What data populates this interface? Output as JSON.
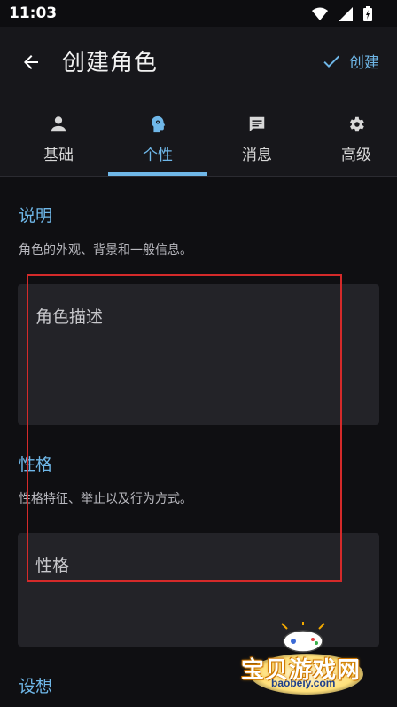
{
  "status_bar": {
    "time": "11:03"
  },
  "app_bar": {
    "title": "创建角色",
    "create_label": "创建"
  },
  "tabs": [
    {
      "label": "基础",
      "icon": "person-icon",
      "active": false
    },
    {
      "label": "个性",
      "icon": "head-gear-icon",
      "active": true
    },
    {
      "label": "消息",
      "icon": "chat-icon",
      "active": false
    },
    {
      "label": "高级",
      "icon": "gear-icon",
      "active": false
    }
  ],
  "sections": {
    "description": {
      "title": "说明",
      "desc": "角色的外观、背景和一般信息。",
      "placeholder": "角色描述"
    },
    "personality": {
      "title": "性格",
      "desc": "性格特征、举止以及行为方式。",
      "placeholder": "性格"
    },
    "scenario": {
      "title": "设想"
    }
  },
  "watermark": {
    "text": "宝贝游戏网",
    "url": "baobeiy.com"
  },
  "colors": {
    "accent": "#6fb7e8",
    "background": "#0f0f12",
    "surface": "#17171b",
    "field": "#232328",
    "highlight_box": "#d42a2a"
  }
}
